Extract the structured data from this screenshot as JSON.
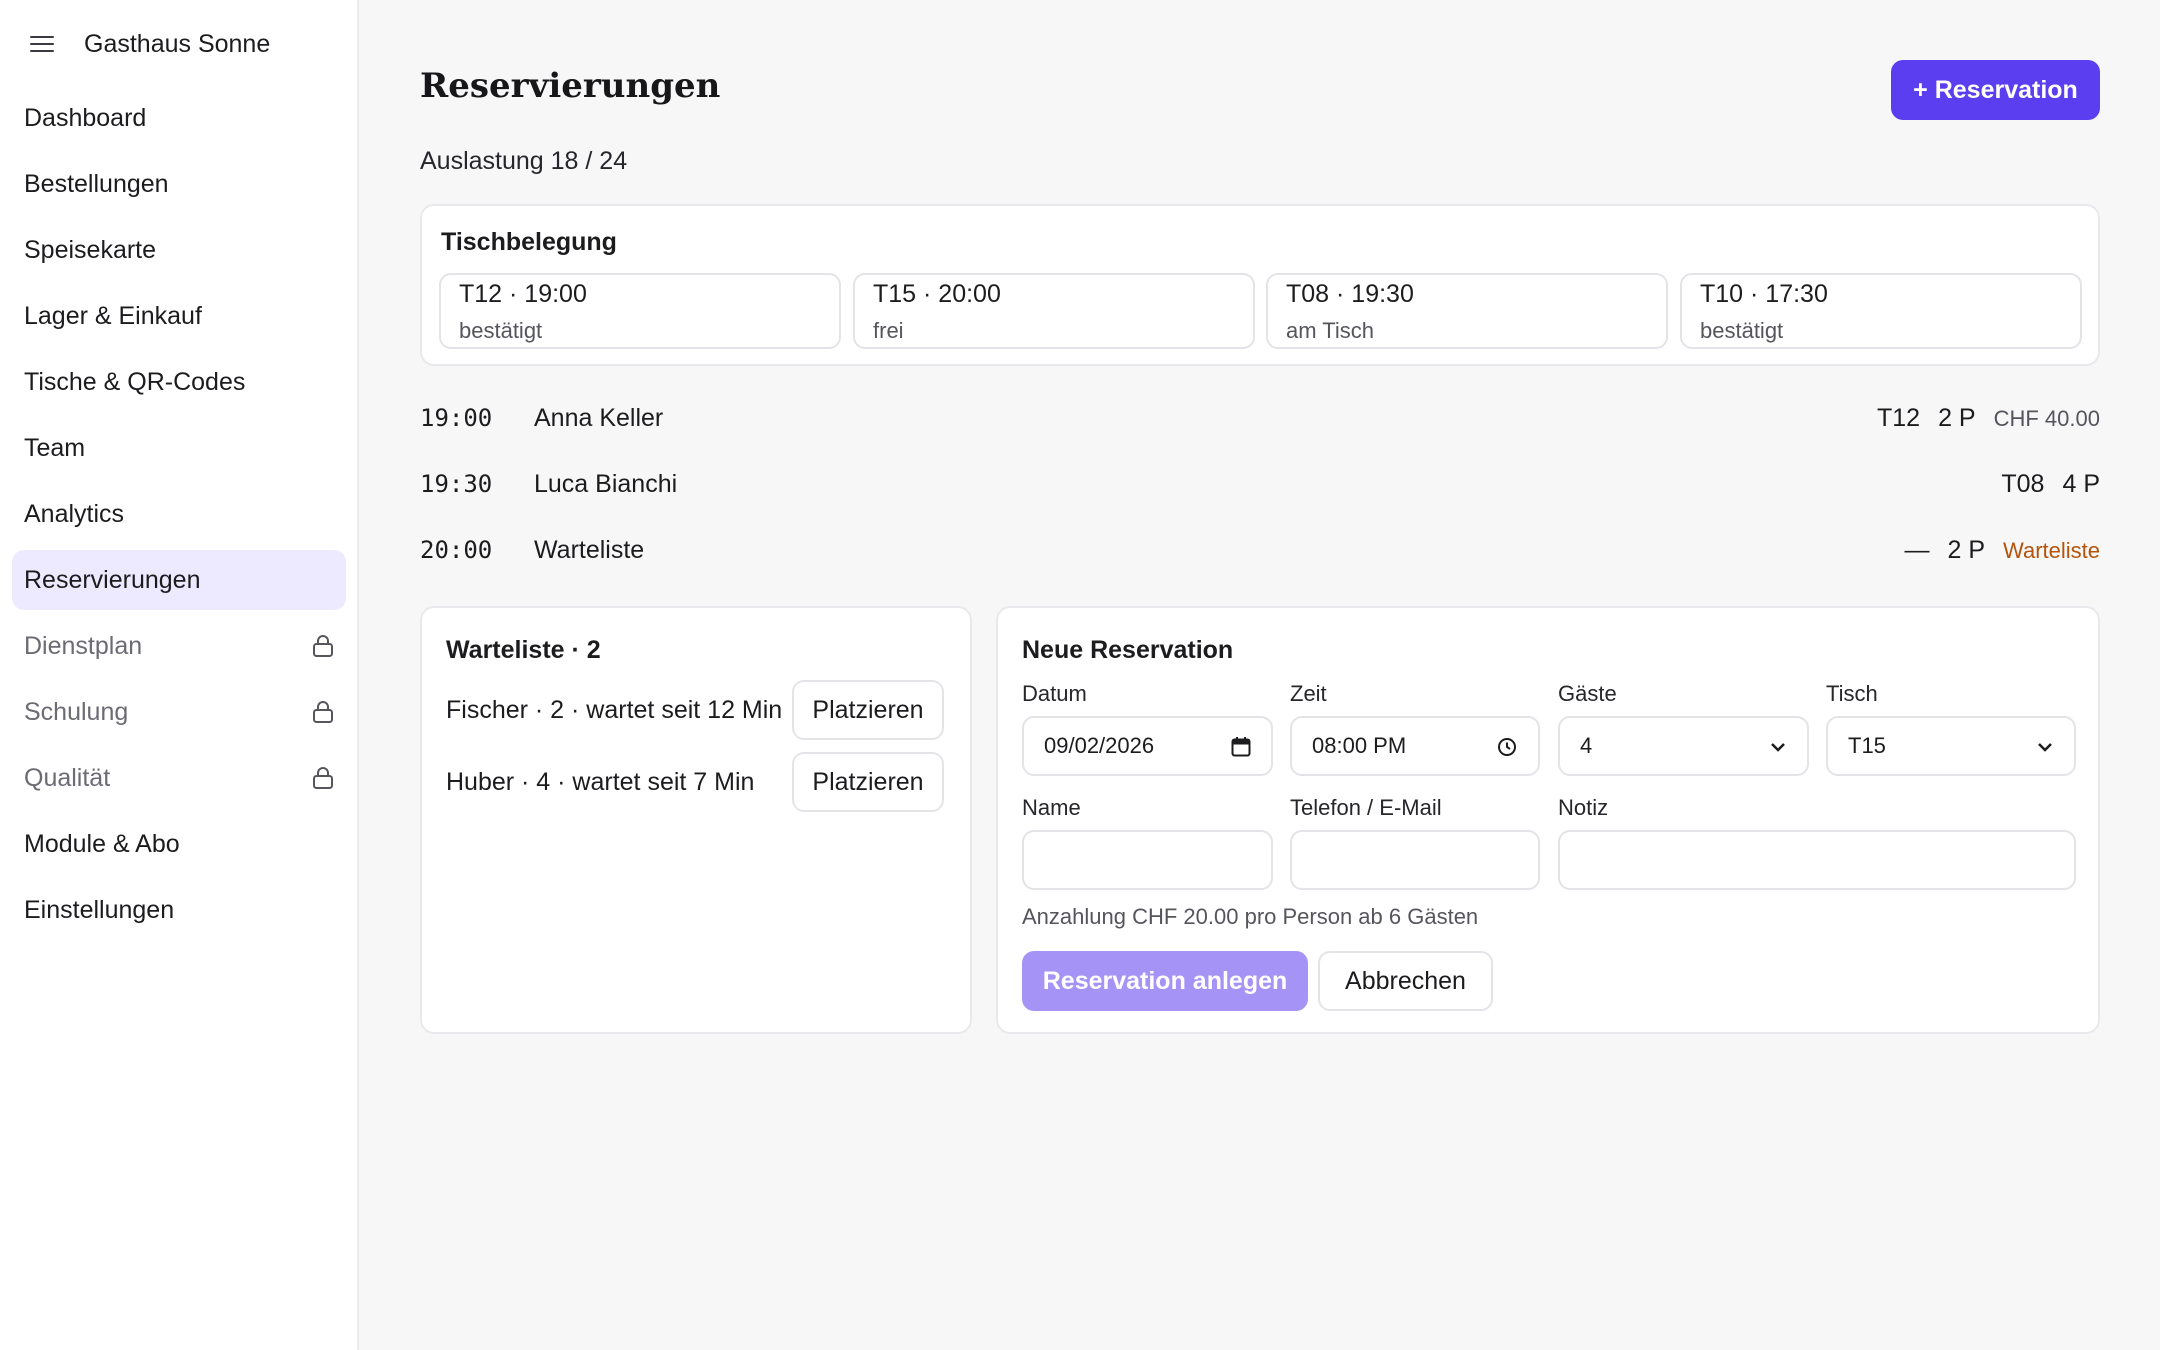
{
  "app": {
    "name": "Gasthaus Sonne"
  },
  "sidebar": {
    "items": [
      {
        "label": "Dashboard"
      },
      {
        "label": "Bestellungen"
      },
      {
        "label": "Speisekarte"
      },
      {
        "label": "Lager & Einkauf"
      },
      {
        "label": "Tische & QR-Codes"
      },
      {
        "label": "Team"
      },
      {
        "label": "Analytics"
      },
      {
        "label": "Reservierungen",
        "active": true
      },
      {
        "label": "Dienstplan",
        "locked": true
      },
      {
        "label": "Schulung",
        "locked": true
      },
      {
        "label": "Qualität",
        "locked": true
      },
      {
        "label": "Module & Abo"
      },
      {
        "label": "Einstellungen"
      }
    ]
  },
  "header": {
    "title": "Reservierungen",
    "new_button": "+ Reservation",
    "occupancy": "Auslastung 18 / 24"
  },
  "tables": {
    "title": "Tischbelegung",
    "chips": [
      {
        "title": "T12 · 19:00",
        "status": "bestätigt"
      },
      {
        "title": "T15 · 20:00",
        "status": "frei"
      },
      {
        "title": "T08 · 19:30",
        "status": "am Tisch"
      },
      {
        "title": "T10 · 17:30",
        "status": "bestätigt"
      }
    ]
  },
  "reservations": [
    {
      "time": "19:00",
      "name": "Anna Keller",
      "table": "T12",
      "persons": "2 P",
      "price": "CHF 40.00"
    },
    {
      "time": "19:30",
      "name": "Luca Bianchi",
      "table": "T08",
      "persons": "4 P"
    },
    {
      "time": "20:00",
      "name": "Warteliste",
      "table": "—",
      "persons": "2 P",
      "tag": "Warteliste"
    }
  ],
  "waitlist": {
    "title": "Warteliste · 2",
    "entries": [
      {
        "text": "Fischer · 2 · wartet seit 12 Min",
        "button": "Platzieren"
      },
      {
        "text": "Huber · 4 · wartet seit 7 Min",
        "button": "Platzieren"
      }
    ]
  },
  "form": {
    "title": "Neue Reservation",
    "date_label": "Datum",
    "date_value": "09/02/2026",
    "time_label": "Zeit",
    "time_value": "08:00 PM",
    "guests_label": "Gäste",
    "guests_value": "4",
    "table_label": "Tisch",
    "table_value": "T15",
    "name_label": "Name",
    "contact_label": "Telefon / E-Mail",
    "note_label": "Notiz",
    "deposit_note": "Anzahlung CHF 20.00 pro Person ab 6 Gästen",
    "submit": "Reservation anlegen",
    "cancel": "Abbrechen"
  },
  "colors": {
    "accent": "#5b3ef0",
    "accent_disabled": "#a594f6",
    "active_nav_bg": "#ede9fe",
    "waitlist_tag": "#b45309"
  }
}
